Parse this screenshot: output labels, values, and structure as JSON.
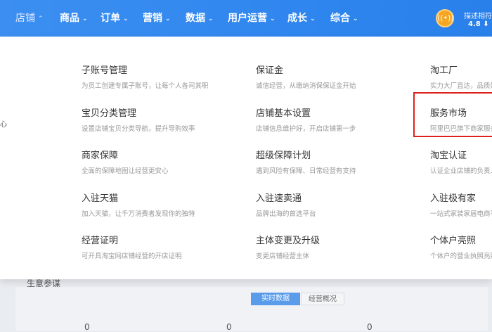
{
  "nav": {
    "items": [
      {
        "label": "店铺",
        "active": true
      },
      {
        "label": "商品"
      },
      {
        "label": "订单"
      },
      {
        "label": "营销"
      },
      {
        "label": "数据"
      },
      {
        "label": "用户运营"
      },
      {
        "label": "成长"
      },
      {
        "label": "综合"
      }
    ],
    "score_label": "描述相符",
    "score_value": "4.8 ⬇"
  },
  "left_stub": {
    "text": "心"
  },
  "menu": {
    "col1": [
      {
        "title": "子账号管理",
        "desc": "为员工创建专属子账号，让每个人各司其职"
      },
      {
        "title": "宝贝分类管理",
        "desc": "设置店铺宝贝分类导航，提升导购效率"
      },
      {
        "title": "商家保障",
        "desc": "全面的保障地图让经营更安心"
      },
      {
        "title": "入驻天猫",
        "desc": "加入天猫，让千万消费者发现你的独特"
      },
      {
        "title": "经营证明",
        "desc": "可开具淘宝网店铺经营的开店证明"
      }
    ],
    "col2": [
      {
        "title": "保证金",
        "desc": "诚信经营，从缴纳消保保证金开始"
      },
      {
        "title": "店铺基本设置",
        "desc": "店铺信息维护好，开启店铺第一步"
      },
      {
        "title": "超级保障计划",
        "desc": "遇到风险有保障、日常经营有支持"
      },
      {
        "title": "入驻速卖通",
        "desc": "品牌出海的首选平台"
      },
      {
        "title": "主体变更及升级",
        "desc": "变更店铺经营主体"
      }
    ],
    "col3": [
      {
        "title": "淘工厂",
        "desc": "实力大厂直达，品质好"
      },
      {
        "title": "服务市场",
        "desc": "阿里巴巴旗下商家服务"
      },
      {
        "title": "淘宝认证",
        "desc": "认证企业店铺的负责人"
      },
      {
        "title": "入驻极有家",
        "desc": "一站式家装家居电商平"
      },
      {
        "title": "个体户亮照",
        "desc": "个体户的营业执照亮照"
      }
    ]
  },
  "background": {
    "section_title": "生意参谋",
    "tabs": [
      "实时数据",
      "经营概况"
    ],
    "numbers": [
      "0",
      "0",
      "0"
    ]
  },
  "colors": {
    "nav_bg": "#2f86ee",
    "highlight": "#e02020",
    "accent": "#5a9bea"
  }
}
